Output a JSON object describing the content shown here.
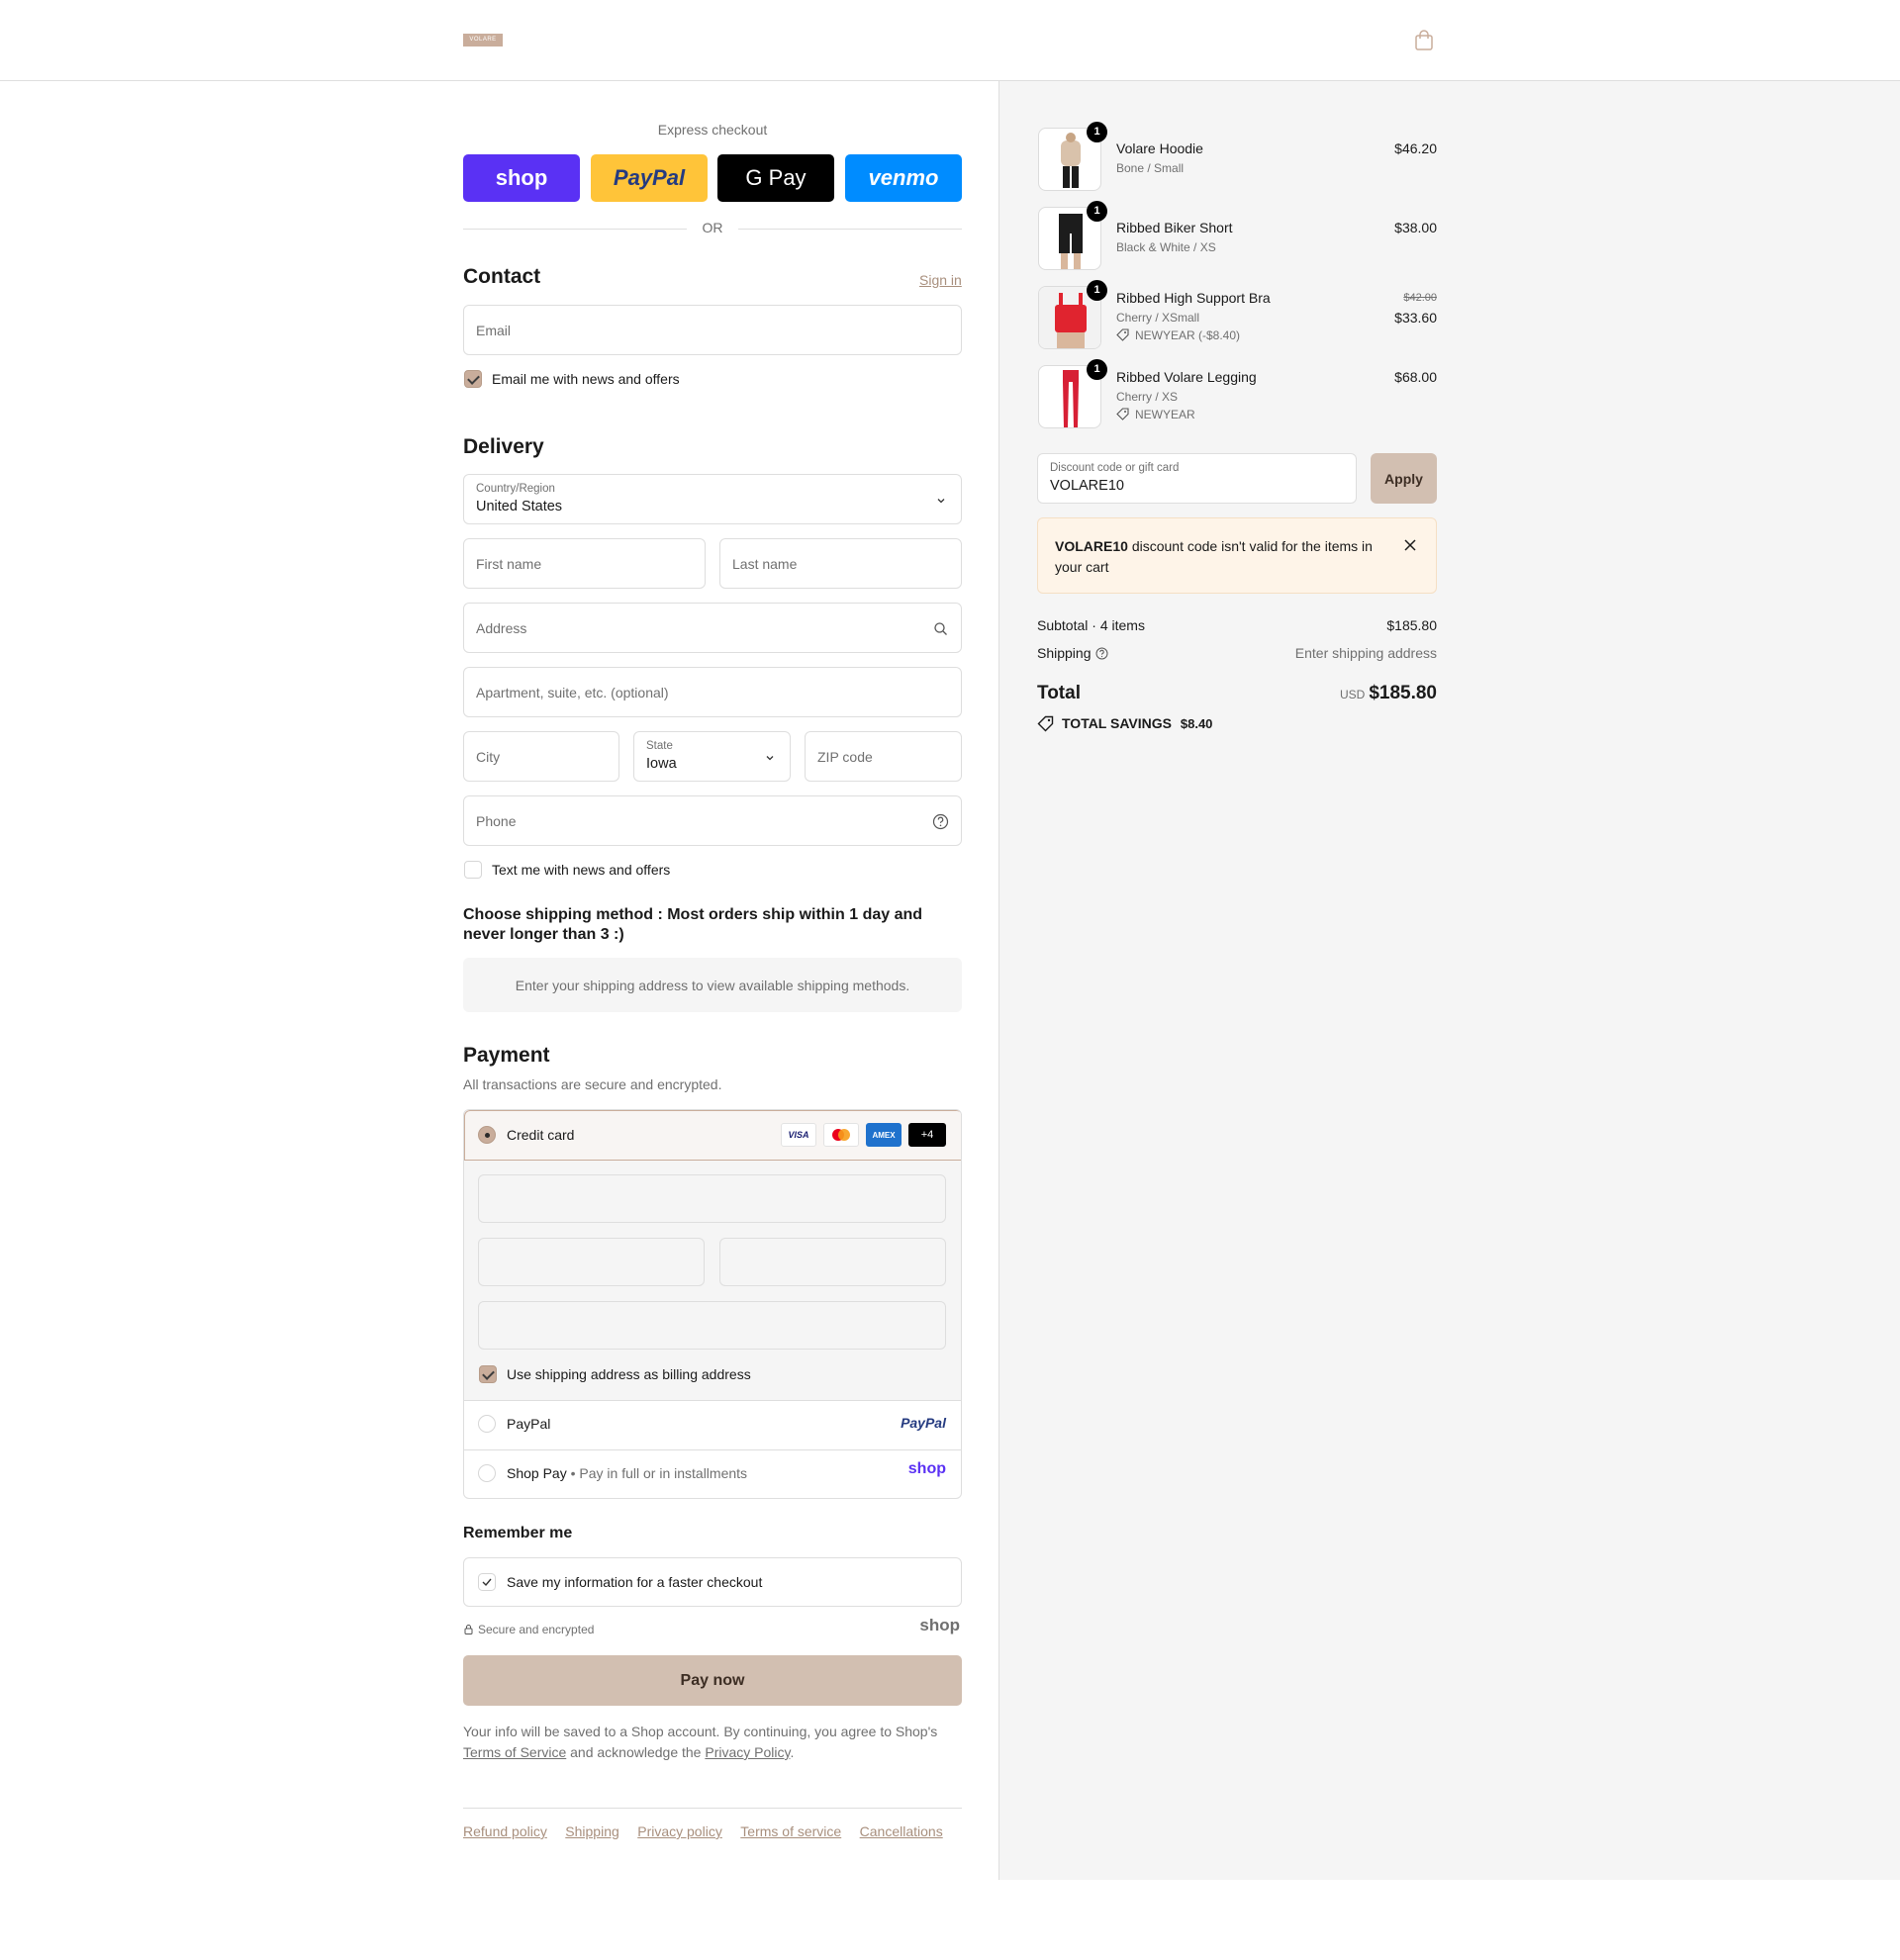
{
  "header": {
    "logo_text": "VOLARE",
    "cart_icon": "shopping-bag-icon"
  },
  "express": {
    "label": "Express checkout",
    "buttons": [
      "shop",
      "PayPal",
      "G Pay",
      "venmo"
    ],
    "colors": {
      "shop": "#5a31f4",
      "paypal": "#ffc439",
      "gpay": "#000000",
      "venmo": "#008cff"
    },
    "or_label": "OR"
  },
  "contact": {
    "title": "Contact",
    "sign_in": "Sign in",
    "email_placeholder": "Email",
    "news_checkbox": "Email me with news and offers"
  },
  "delivery": {
    "title": "Delivery",
    "country_label": "Country/Region",
    "country_value": "United States",
    "first_name": "First name",
    "last_name": "Last name",
    "address": "Address",
    "apartment": "Apartment, suite, etc. (optional)",
    "city": "City",
    "state_label": "State",
    "state_value": "Iowa",
    "zip": "ZIP code",
    "phone": "Phone",
    "text_checkbox": "Text me with news and offers"
  },
  "shipping_method": {
    "title": "Choose shipping method : Most orders ship within 1 day and never longer than 3 :)",
    "notice": "Enter your shipping address to view available shipping methods."
  },
  "payment": {
    "title": "Payment",
    "subtitle": "All transactions are secure and encrypted.",
    "credit_card": "Credit card",
    "card_brands": [
      "VISA",
      "MC",
      "AMEX",
      "+4"
    ],
    "billing_checkbox": "Use shipping address as billing address",
    "paypal": "PayPal",
    "paypal_logo": "PayPal",
    "shop_pay": "Shop Pay",
    "shop_pay_note": "Pay in full or in installments",
    "shop_logo": "shop"
  },
  "remember": {
    "title": "Remember me",
    "save_checkbox": "Save my information for a faster checkout",
    "secure": "Secure and encrypted",
    "shop_logo": "shop"
  },
  "pay_now": "Pay now",
  "legal": {
    "text1": "Your info will be saved to a Shop account. By continuing, you agree to Shop's",
    "tos": "Terms of Service",
    "text2": "and acknowledge the",
    "privacy": "Privacy Policy",
    "period": "."
  },
  "footer_links": [
    "Refund policy",
    "Shipping",
    "Privacy policy",
    "Terms of service",
    "Cancellations"
  ],
  "cart": {
    "items": [
      {
        "qty": "1",
        "name": "Volare Hoodie",
        "variant": "Bone / Small",
        "price": "$46.20",
        "color": "#d9c2ab"
      },
      {
        "qty": "1",
        "name": "Ribbed Biker Short",
        "variant": "Black & White / XS",
        "price": "$38.00",
        "color": "#1c1c1c"
      },
      {
        "qty": "1",
        "name": "Ribbed High Support Bra",
        "variant": "Cherry / XSmall",
        "discount": "NEWYEAR (-$8.40)",
        "old_price": "$42.00",
        "price": "$33.60",
        "color": "#e0242f"
      },
      {
        "qty": "1",
        "name": "Ribbed Volare Legging",
        "variant": "Cherry / XS",
        "discount": "NEWYEAR",
        "price": "$68.00",
        "color": "#d71f35"
      }
    ],
    "discount_label": "Discount code or gift card",
    "discount_value": "VOLARE10",
    "apply": "Apply",
    "error_code": "VOLARE10",
    "error_text": "discount code isn't valid for the items in your cart",
    "subtotal_label": "Subtotal · 4 items",
    "subtotal_value": "$185.80",
    "shipping_label": "Shipping",
    "shipping_value": "Enter shipping address",
    "total_label": "Total",
    "currency": "USD",
    "total_value": "$185.80",
    "savings_label": "TOTAL SAVINGS",
    "savings_value": "$8.40"
  }
}
